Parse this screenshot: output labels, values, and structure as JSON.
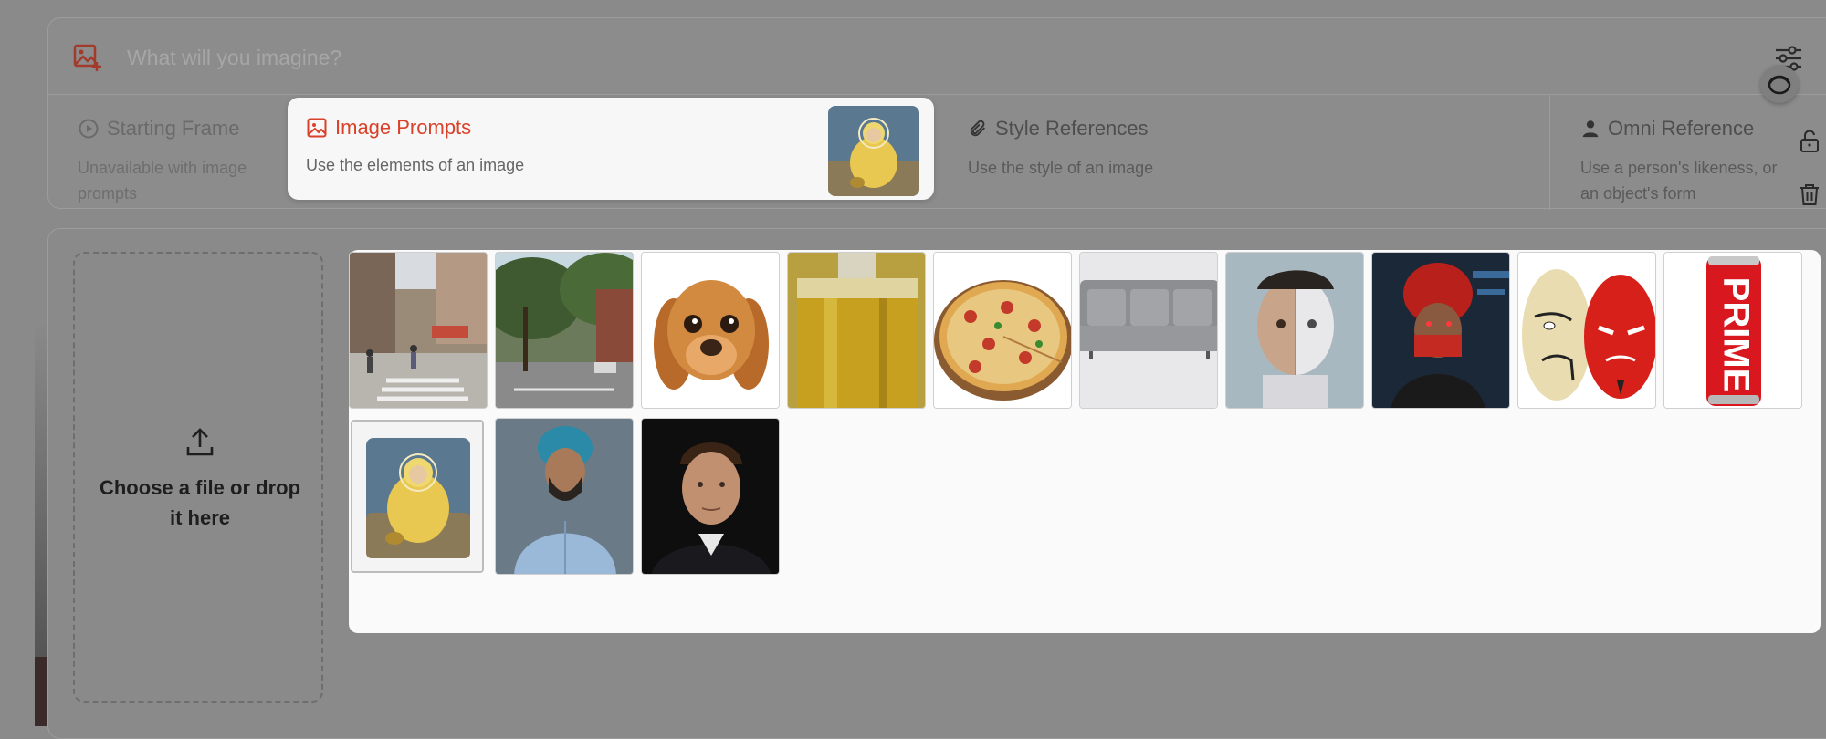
{
  "prompt": {
    "placeholder": "What will you imagine?"
  },
  "tabs": {
    "starting_frame": {
      "title": "Starting Frame",
      "description": "Unavailable with image prompts"
    },
    "image_prompts": {
      "title": "Image Prompts",
      "description": "Use the elements of an image",
      "active": true
    },
    "style_references": {
      "title": "Style References",
      "description": "Use the style of an image"
    },
    "omni_reference": {
      "title": "Omni Reference",
      "description": "Use a person's likeness, or an object's form"
    }
  },
  "dropzone": {
    "label": "Choose a file or drop it here"
  },
  "gallery": {
    "images": [
      {
        "name": "city-street-crosswalk",
        "selected": false
      },
      {
        "name": "tree-lined-street",
        "selected": false
      },
      {
        "name": "cartoon-dog",
        "selected": false
      },
      {
        "name": "oil-bottle",
        "selected": false
      },
      {
        "name": "pizza",
        "selected": false
      },
      {
        "name": "grey-sofa",
        "selected": false
      },
      {
        "name": "half-robot-face",
        "selected": false
      },
      {
        "name": "red-turban-figure",
        "selected": false
      },
      {
        "name": "masks",
        "selected": false
      },
      {
        "name": "prime-drink-can",
        "selected": false
      },
      {
        "name": "guru-painting",
        "selected": true
      },
      {
        "name": "man-blue-turban",
        "selected": false
      },
      {
        "name": "man-portrait",
        "selected": false
      }
    ]
  },
  "icons": {
    "add_image": "image-plus-icon",
    "settings": "sliders-icon",
    "lock": "unlock-icon",
    "trash": "trash-icon",
    "upload": "upload-icon",
    "play": "play-circle-icon",
    "paperclip": "paperclip-icon",
    "person": "person-icon"
  },
  "colors": {
    "accent": "#d9412a",
    "overlay": "#8a8a8a"
  },
  "prime_can_text": "PRIME"
}
